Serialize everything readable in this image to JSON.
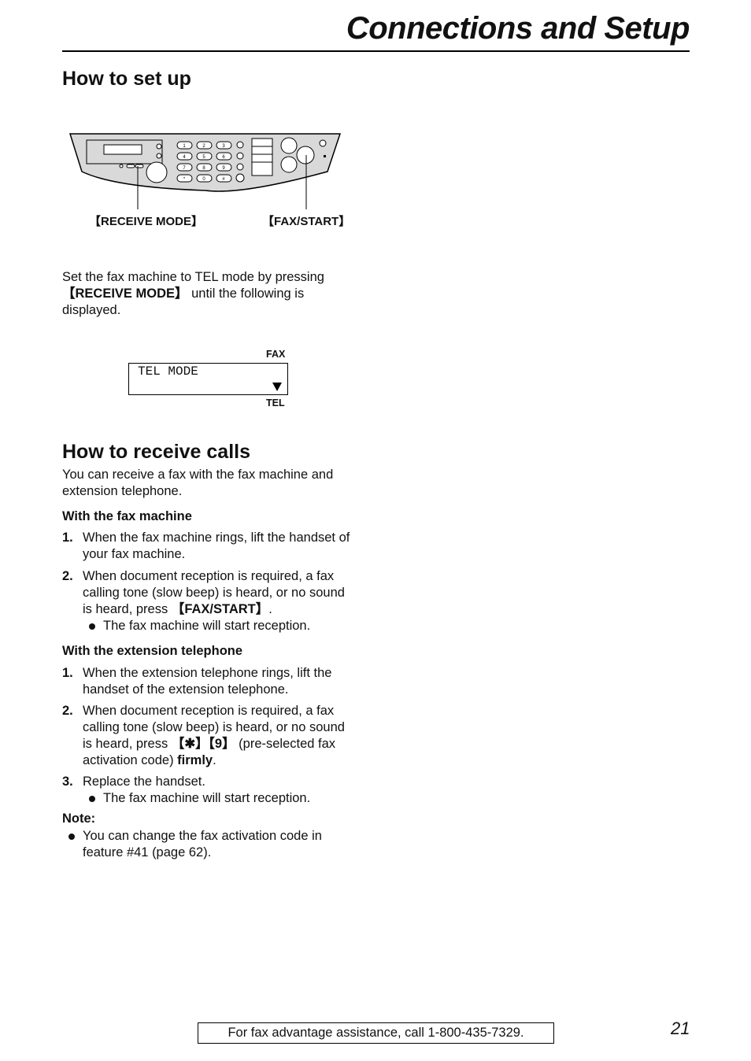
{
  "header": {
    "title": "Connections and Setup"
  },
  "setup": {
    "heading": "How to set up",
    "diagram": {
      "labels": {
        "receive_mode": "【RECEIVE MODE】",
        "fax_start": "【FAX/START】"
      },
      "keypad": [
        "1",
        "2",
        "3",
        "4",
        "5",
        "6",
        "7",
        "8",
        "9",
        "*",
        "0",
        "#"
      ]
    },
    "instruction_pre": "Set the fax machine to TEL mode by pressing",
    "instruction_key": "【RECEIVE MODE】",
    "instruction_post": " until the following is displayed.",
    "display": {
      "text": "TEL MODE",
      "label_top": "FAX",
      "label_bottom": "TEL"
    }
  },
  "receive": {
    "heading": "How to receive calls",
    "intro": "You can receive a fax with the fax machine and extension telephone.",
    "fax_machine": {
      "heading": "With the fax machine",
      "steps": [
        {
          "num": "1.",
          "text": "When the fax machine rings, lift the handset of your fax machine."
        },
        {
          "num": "2.",
          "text_pre": "When document reception is required, a fax calling tone (slow beep) is heard, or no sound is heard, press ",
          "key": "【FAX/START】",
          "text_post": ".",
          "bullet": "The fax machine will start reception."
        }
      ]
    },
    "extension": {
      "heading": "With the extension telephone",
      "steps": [
        {
          "num": "1.",
          "text": "When the extension telephone rings, lift the handset of the extension telephone."
        },
        {
          "num": "2.",
          "text_pre": "When document reception is required, a fax calling tone (slow beep) is heard, or no sound is heard, press ",
          "key": "【✱】【9】",
          "text_mid": " (pre-selected fax activation code) ",
          "bold_word": "firmly",
          "text_post": "."
        },
        {
          "num": "3.",
          "text": "Replace the handset.",
          "bullet": "The fax machine will start reception."
        }
      ]
    },
    "note": {
      "heading": "Note:",
      "bullet": "You can change the fax activation code in feature #41 (page 62)."
    }
  },
  "footer": {
    "assistance": "For fax advantage assistance, call 1-800-435-7329.",
    "page_number": "21"
  }
}
